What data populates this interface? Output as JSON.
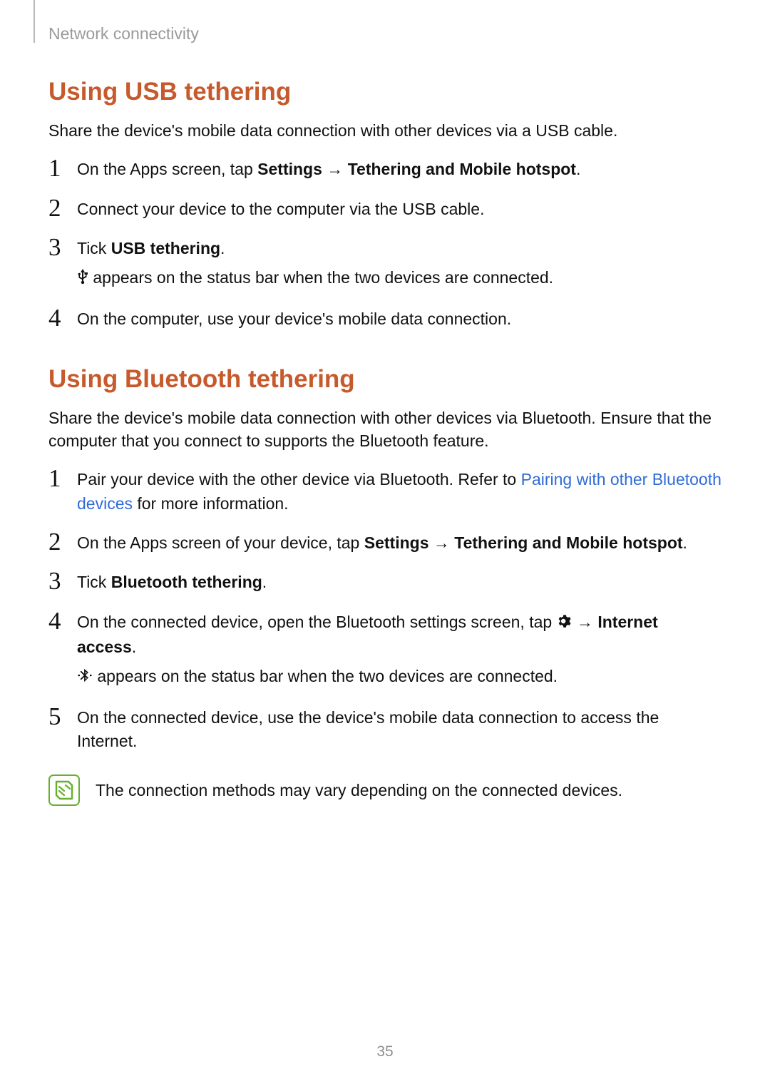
{
  "breadcrumb": "Network connectivity",
  "usb": {
    "heading": "Using USB tethering",
    "intro": "Share the device's mobile data connection with other devices via a USB cable.",
    "step1_pre": "On the Apps screen, tap ",
    "step1_b1": "Settings",
    "step1_arrow": " → ",
    "step1_b2": "Tethering and Mobile hotspot",
    "step1_tail": ".",
    "step2": "Connect your device to the computer via the USB cable.",
    "step3_pre": "Tick ",
    "step3_b": "USB tethering",
    "step3_tail": ".",
    "step3_sub": " appears on the status bar when the two devices are connected.",
    "step4": "On the computer, use your device's mobile data connection."
  },
  "bt": {
    "heading": "Using Bluetooth tethering",
    "intro": "Share the device's mobile data connection with other devices via Bluetooth. Ensure that the computer that you connect to supports the Bluetooth feature.",
    "step1_pre": "Pair your device with the other device via Bluetooth. Refer to ",
    "step1_link": "Pairing with other Bluetooth devices",
    "step1_post": " for more information.",
    "step2_pre": "On the Apps screen of your device, tap ",
    "step2_b1": "Settings",
    "step2_arrow": " → ",
    "step2_b2": "Tethering and Mobile hotspot",
    "step2_tail": ".",
    "step3_pre": "Tick ",
    "step3_b": "Bluetooth tethering",
    "step3_tail": ".",
    "step4_pre": "On the connected device, open the Bluetooth settings screen, tap ",
    "step4_arrow": " → ",
    "step4_b": "Internet access",
    "step4_tail": ".",
    "step4_sub": " appears on the status bar when the two devices are connected.",
    "step5": "On the connected device, use the device's mobile data connection to access the Internet.",
    "note": "The connection methods may vary depending on the connected devices."
  },
  "pageNumber": "35"
}
